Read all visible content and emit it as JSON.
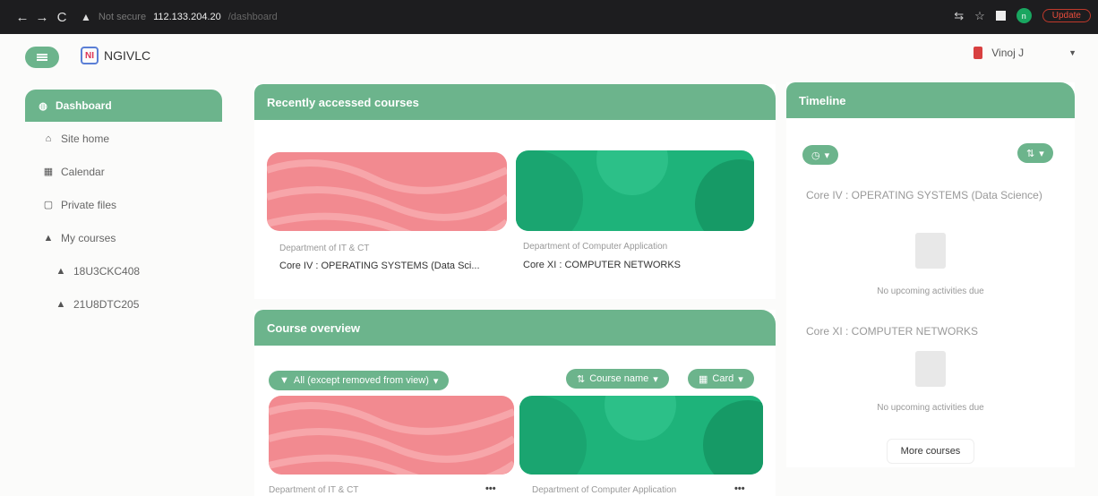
{
  "browser": {
    "address_security": "Not secure",
    "address_ip": "112.133.204.20",
    "address_path": "/dashboard",
    "update_label": "Update",
    "profile_initial": "n"
  },
  "header": {
    "brand": "NGIVLC",
    "brand_logo_text": "NI",
    "user_name": "Vinoj J"
  },
  "sidebar": {
    "items": [
      {
        "label": "Dashboard",
        "icon": "dashboard-icon"
      },
      {
        "label": "Site home",
        "icon": "home-icon"
      },
      {
        "label": "Calendar",
        "icon": "calendar-icon"
      },
      {
        "label": "Private files",
        "icon": "file-icon"
      },
      {
        "label": "My courses",
        "icon": "graduation-cap-icon"
      },
      {
        "label": "18U3CKC408",
        "icon": "graduation-cap-icon"
      },
      {
        "label": "21U8DTC205",
        "icon": "graduation-cap-icon"
      }
    ]
  },
  "recent": {
    "title": "Recently accessed courses",
    "courses": [
      {
        "dept": "Department of IT & CT",
        "name": "Core IV : OPERATING SYSTEMS (Data Sci...",
        "color": "#f28a90"
      },
      {
        "dept": "Department of Computer Application",
        "name": "Core XI : COMPUTER NETWORKS",
        "color": "#1eb37a"
      }
    ]
  },
  "overview": {
    "title": "Course overview",
    "filter_label": "All (except removed from view)",
    "sort_label": "Course name",
    "view_label": "Card",
    "courses": [
      {
        "dept": "Department of IT & CT",
        "color": "#f28a90"
      },
      {
        "dept": "Department of Computer Application",
        "color": "#1eb37a"
      }
    ]
  },
  "timeline": {
    "title": "Timeline",
    "items": [
      {
        "course": "Core IV : OPERATING SYSTEMS (Data Science)",
        "empty": "No upcoming activities due"
      },
      {
        "course": "Core XI : COMPUTER NETWORKS",
        "empty": "No upcoming activities due"
      }
    ],
    "more_label": "More courses"
  },
  "colors": {
    "accent": "#6cb48c",
    "chrome": "#1d1d1f"
  }
}
